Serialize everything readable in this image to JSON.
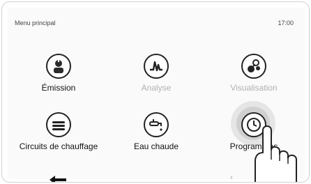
{
  "header": {
    "title": "Menu principal",
    "time": "17:00"
  },
  "tiles": [
    {
      "label": "Émission",
      "icon": "emission-icon",
      "state": "active"
    },
    {
      "label": "Analyse",
      "icon": "analysis-icon",
      "state": "disabled"
    },
    {
      "label": "Visualisation",
      "icon": "visualisation-icon",
      "state": "disabled"
    },
    {
      "label": "Circuits de chauffage",
      "icon": "heating-circuits-icon",
      "state": "active"
    },
    {
      "label": "Eau chaude",
      "icon": "hot-water-icon",
      "state": "active"
    },
    {
      "label": "Programmes",
      "icon": "programs-icon",
      "state": "active"
    }
  ],
  "footer": {
    "back_icon": "back-arrow-icon",
    "page_prev_icon": "chevron-left-icon"
  },
  "overlay": {
    "touch_icon": "finger-touch-icon"
  }
}
